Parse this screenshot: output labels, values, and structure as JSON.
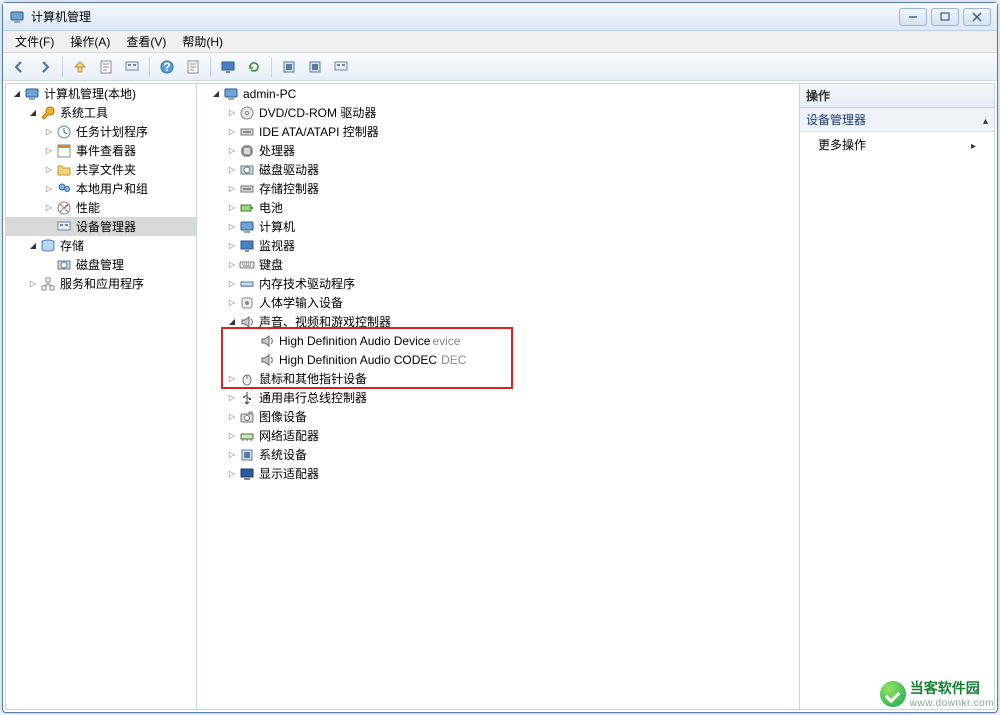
{
  "window": {
    "title": "计算机管理"
  },
  "menu": {
    "file": "文件(F)",
    "action": "操作(A)",
    "view": "查看(V)",
    "help": "帮助(H)"
  },
  "actions": {
    "header": "操作",
    "device_manager": "设备管理器",
    "more": "更多操作"
  },
  "left_tree": {
    "root": "计算机管理(本地)",
    "system_tools": "系统工具",
    "task_scheduler": "任务计划程序",
    "event_viewer": "事件查看器",
    "shared_folders": "共享文件夹",
    "local_users": "本地用户和组",
    "performance": "性能",
    "device_manager": "设备管理器",
    "storage": "存储",
    "disk_mgmt": "磁盘管理",
    "services_apps": "服务和应用程序"
  },
  "center_tree": {
    "root": "admin-PC",
    "dvd": "DVD/CD-ROM 驱动器",
    "ide": "IDE ATA/ATAPI 控制器",
    "cpu": "处理器",
    "floppy": "磁盘驱动器",
    "storage_ctrl": "存储控制器",
    "battery": "电池",
    "computer": "计算机",
    "monitor": "监视器",
    "keyboard": "键盘",
    "memtech": "内存技术驱动程序",
    "hid": "人体学输入设备",
    "sound": "声音、视频和游戏控制器",
    "sound_dev1": "High Definition Audio Device",
    "sound_dev1_ghost": "evice",
    "sound_dev2": "High Definition Audio CODEC",
    "sound_dev2_ghost": "DEC",
    "mouse": "鼠标和其他指针设备",
    "usb": "通用串行总线控制器",
    "imaging": "图像设备",
    "network": "网络适配器",
    "system_dev": "系统设备",
    "display": "显示适配器"
  },
  "watermark": {
    "name": "当客软件园",
    "url": "www.downkr.com"
  }
}
